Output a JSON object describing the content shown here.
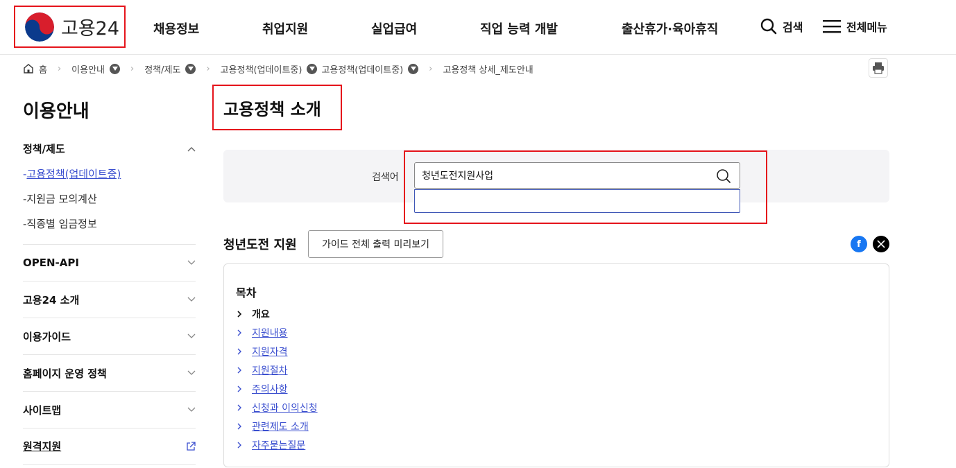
{
  "header": {
    "logo_text": "고용24",
    "nav": [
      "채용정보",
      "취업지원",
      "실업급여",
      "직업 능력 개발",
      "출산휴가·육아휴직"
    ],
    "search_label": "검색",
    "menu_label": "전체메뉴"
  },
  "breadcrumb": {
    "home": "홈",
    "items": [
      "이용안내",
      "정책/제도",
      "고용정책(업데이트중)",
      "고용정책(업데이트중)",
      "고용정책 상세_제도안내"
    ]
  },
  "sidebar": {
    "title": "이용안내",
    "group_title": "정책/제도",
    "sub_items": [
      "-고용정책(업데이트중)",
      "-지원금 모의계산",
      "-직종별 임금정보"
    ],
    "rows": [
      "OPEN-API",
      "고용24 소개",
      "이용가이드",
      "홈페이지 운영 정책",
      "사이트맵",
      "원격지원"
    ]
  },
  "main": {
    "page_title": "고용정책 소개",
    "search": {
      "label": "검색어",
      "value": "청년도전지원사업"
    },
    "section_title": "청년도전 지원",
    "guide_button": "가이드 전체 출력 미리보기",
    "toc": {
      "title": "목차",
      "items": [
        "개요",
        "지원내용",
        "지원자격",
        "지원절차",
        "주의사항",
        "신청과 이의신청",
        "관련제도 소개",
        "자주묻는질문"
      ]
    }
  },
  "colors": {
    "accent_red": "#e5141b",
    "link_blue": "#3b4fcf",
    "facebook": "#1877f2",
    "x": "#000000"
  },
  "icons": [
    "logo-taegeuk-icon",
    "search-icon",
    "hamburger-icon",
    "home-icon",
    "print-icon",
    "facebook-icon",
    "x-icon",
    "external-link-icon",
    "chevron-down-icon",
    "chevron-up-icon",
    "chevron-right-icon"
  ]
}
